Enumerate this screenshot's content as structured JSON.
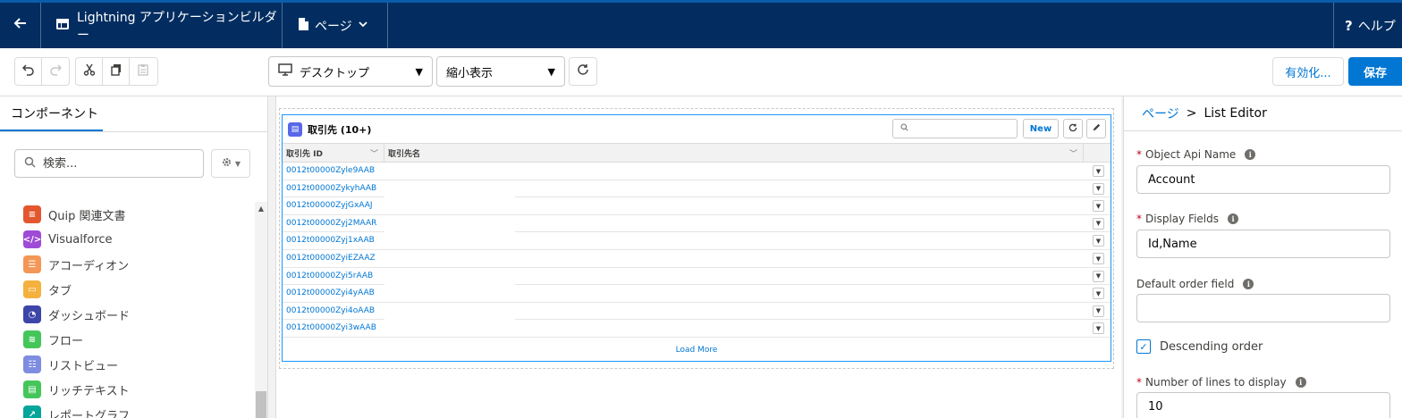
{
  "topbar": {
    "app_title": "Lightning アプリケーションビルダー",
    "page_menu": "ページ",
    "help": "ヘルプ"
  },
  "toolbar": {
    "device_select": "デスクトップ",
    "zoom_select": "縮小表示",
    "activate_label": "有効化...",
    "save_label": "保存"
  },
  "left_panel": {
    "tab_label": "コンポーネント",
    "search_placeholder": "検索...",
    "components": [
      {
        "label": "Quip 関連文書",
        "icon": "quip-icon",
        "color": "#e4572e"
      },
      {
        "label": "Visualforce",
        "icon": "visualforce-icon",
        "color": "#9e4bd6"
      },
      {
        "label": "アコーディオン",
        "icon": "accordion-icon",
        "color": "#f49756"
      },
      {
        "label": "タブ",
        "icon": "tabs-icon",
        "color": "#f4b13e"
      },
      {
        "label": "ダッシュボード",
        "icon": "dashboard-icon",
        "color": "#3d45a8"
      },
      {
        "label": "フロー",
        "icon": "flow-icon",
        "color": "#45c65a"
      },
      {
        "label": "リストビュー",
        "icon": "listview-icon",
        "color": "#7f8de1"
      },
      {
        "label": "リッチテキスト",
        "icon": "richtext-icon",
        "color": "#45c65a"
      },
      {
        "label": "レポートグラフ",
        "icon": "report-chart-icon",
        "color": "#06a59a"
      }
    ]
  },
  "list_card": {
    "title": "取引先 (10+)",
    "new_label": "New",
    "columns": [
      "取引先 ID",
      "取引先名"
    ],
    "rows": [
      "0012t00000Zyle9AAB",
      "0012t00000ZykyhAAB",
      "0012t00000ZyjGxAAJ",
      "0012t00000Zyj2MAAR",
      "0012t00000Zyj1xAAB",
      "0012t00000ZyiEZAAZ",
      "0012t00000Zyi5rAAB",
      "0012t00000Zyi4yAAB",
      "0012t00000Zyi4oAAB",
      "0012t00000Zyi3wAAB"
    ],
    "load_more": "Load More"
  },
  "right_panel": {
    "breadcrumb_root": "ページ",
    "breadcrumb_sep": ">",
    "breadcrumb_current": "List Editor",
    "object_api_name_label": "Object Api Name",
    "object_api_name_value": "Account",
    "display_fields_label": "Display Fields",
    "display_fields_value": "Id,Name",
    "default_order_label": "Default order field",
    "default_order_value": "",
    "descending_label": "Descending order",
    "lines_label": "Number of lines to display",
    "lines_value": "10"
  }
}
